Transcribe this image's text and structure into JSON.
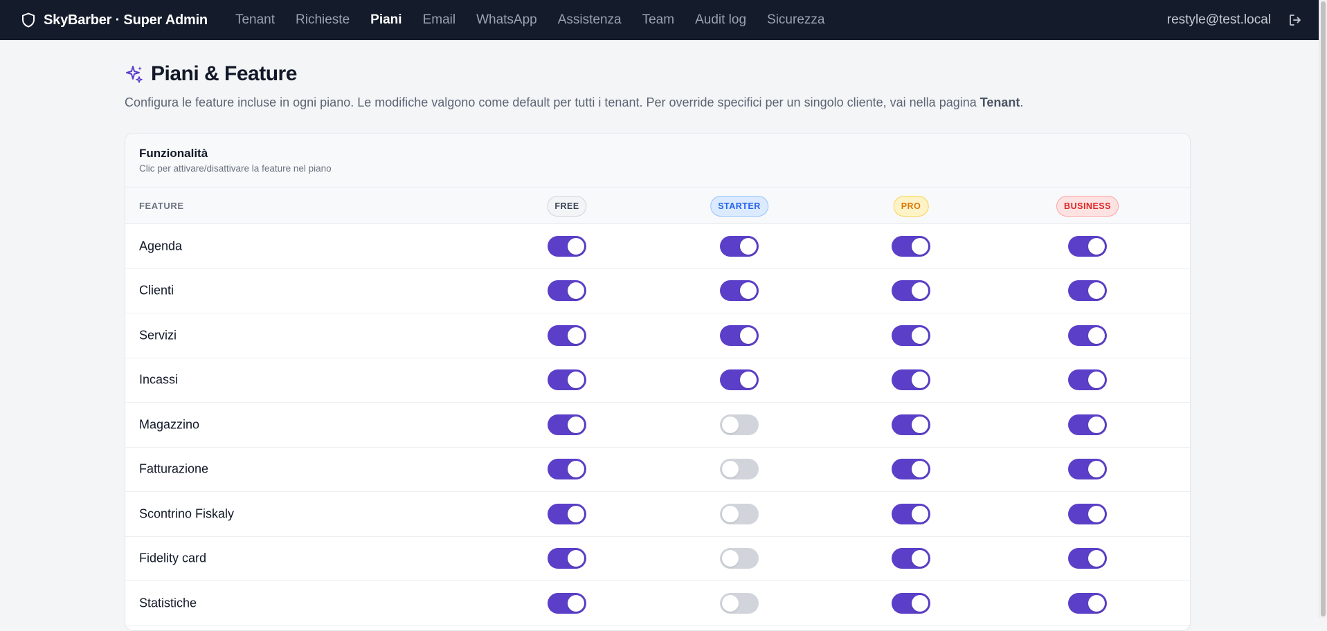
{
  "app": {
    "title": "SkyBarber · Super Admin",
    "user_email": "restyle@test.local"
  },
  "nav": {
    "items": [
      {
        "label": "Tenant",
        "active": false
      },
      {
        "label": "Richieste",
        "active": false
      },
      {
        "label": "Piani",
        "active": true
      },
      {
        "label": "Email",
        "active": false
      },
      {
        "label": "WhatsApp",
        "active": false
      },
      {
        "label": "Assistenza",
        "active": false
      },
      {
        "label": "Team",
        "active": false
      },
      {
        "label": "Audit log",
        "active": false
      },
      {
        "label": "Sicurezza",
        "active": false
      }
    ]
  },
  "page": {
    "title": "Piani & Feature",
    "description_prefix": "Configura le feature incluse in ogni piano. Le modifiche valgono come default per tutti i tenant. Per override specifici per un singolo cliente, vai nella pagina ",
    "description_link": "Tenant",
    "description_suffix": "."
  },
  "card": {
    "title": "Funzionalità",
    "subtitle": "Clic per attivare/disattivare la feature nel piano"
  },
  "table": {
    "feature_header": "FEATURE",
    "plans": [
      {
        "key": "free",
        "label": "FREE",
        "color": "#374151"
      },
      {
        "key": "starter",
        "label": "STARTER",
        "color": "#2563eb"
      },
      {
        "key": "pro",
        "label": "PRO",
        "color": "#d97706"
      },
      {
        "key": "business",
        "label": "BUSINESS",
        "color": "#dc2626"
      }
    ],
    "rows": [
      {
        "feature": "Agenda",
        "enabled": [
          true,
          true,
          true,
          true
        ]
      },
      {
        "feature": "Clienti",
        "enabled": [
          true,
          true,
          true,
          true
        ]
      },
      {
        "feature": "Servizi",
        "enabled": [
          true,
          true,
          true,
          true
        ]
      },
      {
        "feature": "Incassi",
        "enabled": [
          true,
          true,
          true,
          true
        ]
      },
      {
        "feature": "Magazzino",
        "enabled": [
          true,
          false,
          true,
          true
        ]
      },
      {
        "feature": "Fatturazione",
        "enabled": [
          true,
          false,
          true,
          true
        ]
      },
      {
        "feature": "Scontrino Fiskaly",
        "enabled": [
          true,
          false,
          true,
          true
        ]
      },
      {
        "feature": "Fidelity card",
        "enabled": [
          true,
          false,
          true,
          true
        ]
      },
      {
        "feature": "Statistiche",
        "enabled": [
          true,
          false,
          true,
          true
        ]
      }
    ]
  },
  "colors": {
    "accent": "#5b3fc8",
    "topbar": "#141b2b",
    "toggle_off": "#d1d5db"
  },
  "icons": {
    "brand": "shield-icon",
    "title": "sparkle-icon",
    "logout": "logout-icon"
  }
}
